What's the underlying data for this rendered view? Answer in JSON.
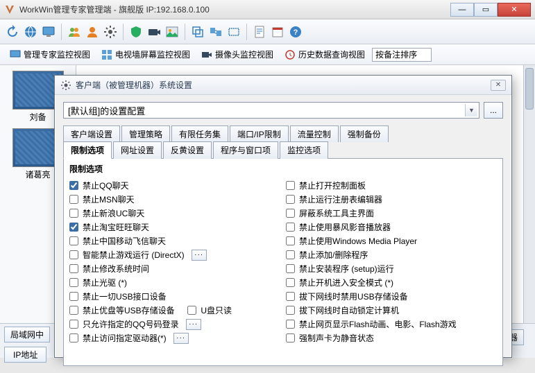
{
  "window": {
    "title": "WorkWin管理专家管理端 - 旗舰版 IP:192.168.0.100"
  },
  "viewbar": {
    "item1": "管理专家监控视图",
    "item2": "电视墙屏幕监控视图",
    "item3": "摄像头监控视图",
    "item4": "历史数据查询视图",
    "sort_label": "按备注排序"
  },
  "thumbs": {
    "t1": "刘备",
    "t2": "诸葛亮"
  },
  "bottom": {
    "lan_btn": "局域网中",
    "ip_btn": "IP地址",
    "monitor_btn": "监视机器"
  },
  "dialog": {
    "title": "客户端（被管理机器）系统设置",
    "combo_value": "[默认组]的设置配置",
    "browse": "...",
    "tabs_row1": {
      "t0": "客户端设置",
      "t1": "管理策略",
      "t2": "有限任务集",
      "t3": "端口/IP限制",
      "t4": "流量控制",
      "t5": "强制备份"
    },
    "tabs_row2": {
      "t0": "限制选项",
      "t1": "网址设置",
      "t2": "反黄设置",
      "t3": "程序与窗口项",
      "t4": "监控选项"
    },
    "group_title": "限制选项",
    "left": {
      "c0": "禁止QQ聊天",
      "c1": "禁止MSN聊天",
      "c2": "禁止新浪UC聊天",
      "c3": "禁止淘宝旺旺聊天",
      "c4": "禁止中国移动飞信聊天",
      "c5": "智能禁止游戏运行 (DirectX)",
      "c6": "禁止修改系统时间",
      "c7": "禁止光驱 (*)",
      "c8": "禁止一切USB接口设备",
      "c9": "禁止优盘等USB存储设备",
      "c9b": "U盘只读",
      "c10": "只允许指定的QQ号码登录",
      "c11": "禁止访问指定驱动器(*)"
    },
    "right": {
      "c0": "禁止打开控制面板",
      "c1": "禁止运行注册表编辑器",
      "c2": "屏蔽系统工具主界面",
      "c3": "禁止使用暴风影音播放器",
      "c4": "禁止使用Windows Media Player",
      "c5": "禁止添加/删除程序",
      "c6": "禁止安装程序 (setup)运行",
      "c7": "禁止开机进入安全模式 (*)",
      "c8": "拔下网线时禁用USB存储设备",
      "c9": "拔下网线时自动锁定计算机",
      "c10": "禁止网页显示Flash动画、电影、Flash游戏",
      "c11": "强制声卡为静音状态"
    }
  }
}
